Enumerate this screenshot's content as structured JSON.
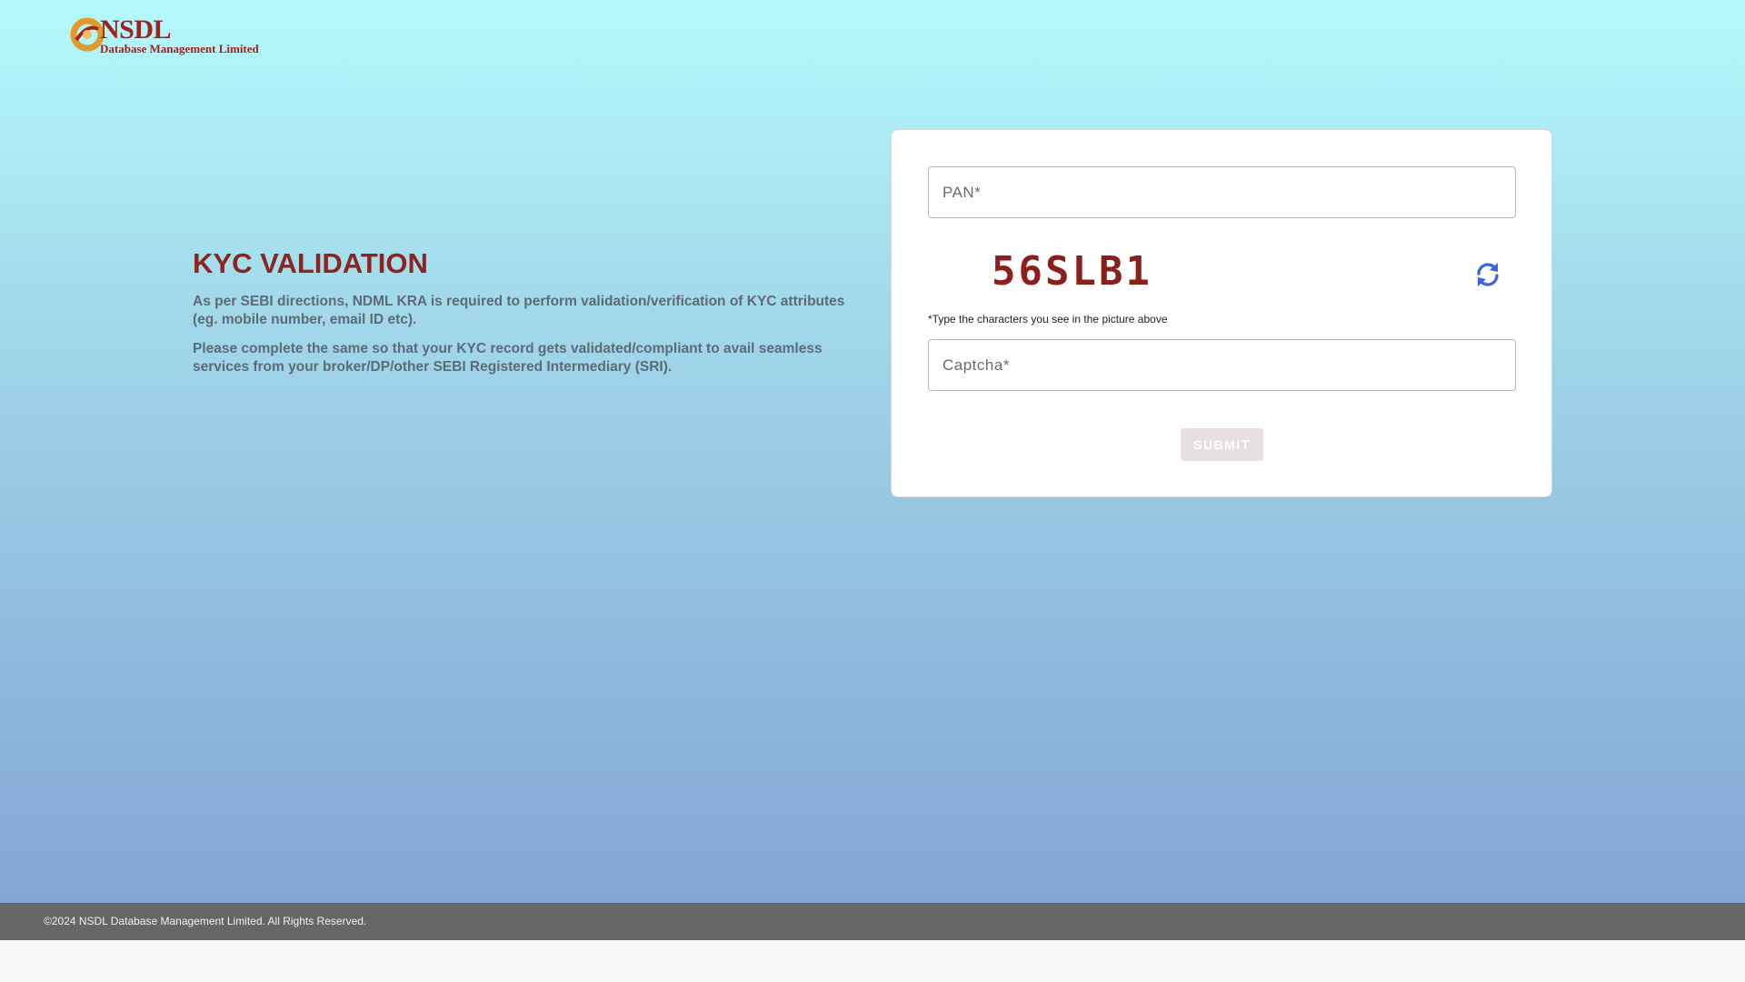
{
  "logo": {
    "name": "NSDL",
    "subtitle": "Database Management Limited"
  },
  "intro": {
    "title": "KYC VALIDATION",
    "paragraph1": "As per SEBI directions, NDML KRA is required to perform validation/verification of KYC attributes (eg. mobile number, email ID etc).",
    "paragraph2": "Please complete the same so that your KYC record gets validated/compliant to avail seamless services from your broker/DP/other SEBI Registered Intermediary (SRI)."
  },
  "form": {
    "pan_placeholder": "PAN*",
    "pan_value": "",
    "captcha_text": "56SLB1",
    "captcha_hint": "*Type the characters you see in the picture above",
    "captcha_placeholder": "Captcha*",
    "captcha_value": "",
    "submit_label": "SUBMIT",
    "refresh_icon": "refresh-icon"
  },
  "footer": {
    "copyright": "©2024 NSDL Database Management Limited. All Rights Reserved."
  },
  "colors": {
    "brand_red": "#8b2521",
    "refresh_blue": "#3d63d8",
    "submit_disabled_bg": "#e8dfe1"
  }
}
